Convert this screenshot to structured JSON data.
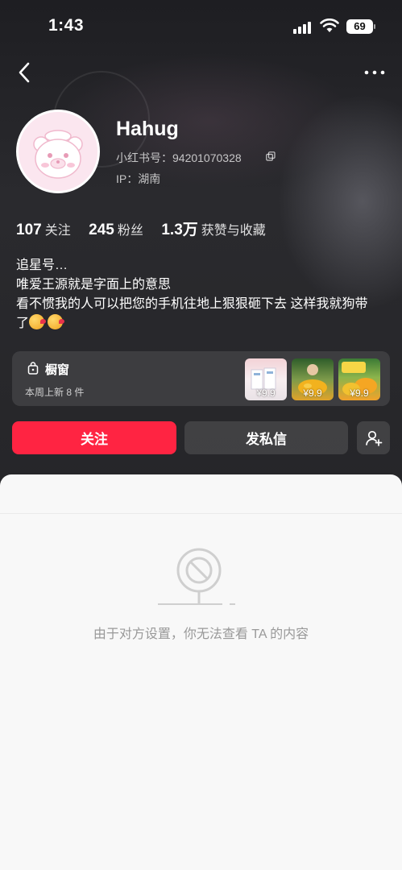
{
  "status_bar": {
    "time": "1:43",
    "battery": "69"
  },
  "profile": {
    "username": "Hahug",
    "redbook_id": "小红书号：94201070328",
    "ip_location": "IP：湖南"
  },
  "stats": [
    {
      "value": "107",
      "label": "关注"
    },
    {
      "value": "245",
      "label": "粉丝"
    },
    {
      "value": "1.3万",
      "label": "获赞与收藏"
    }
  ],
  "bio": {
    "line1": "追星号…",
    "line2": "唯爱王源就是字面上的意思",
    "line3": "看不惯我的人可以把您的手机往地上狠狠砸下去 这样我就狗带",
    "line4": "了"
  },
  "shop": {
    "title": "橱窗",
    "subtitle": "本周上新 8 件",
    "products": [
      {
        "price": "¥9.9"
      },
      {
        "price": "¥9.9"
      },
      {
        "price": "¥9.9"
      }
    ]
  },
  "actions": {
    "follow": "关注",
    "message": "发私信"
  },
  "content": {
    "blocked_message": "由于对方设置，你无法查看 TA 的内容"
  },
  "colors": {
    "accent": "#ff2442",
    "header_bg": "#262629",
    "sheet_bg": "#f8f8f8"
  },
  "icons": [
    "back-arrow-icon",
    "more-icon",
    "copy-icon",
    "bag-icon",
    "add-friend-icon",
    "blocked-icon",
    "wifi-icon",
    "signal-icon",
    "battery-icon"
  ]
}
